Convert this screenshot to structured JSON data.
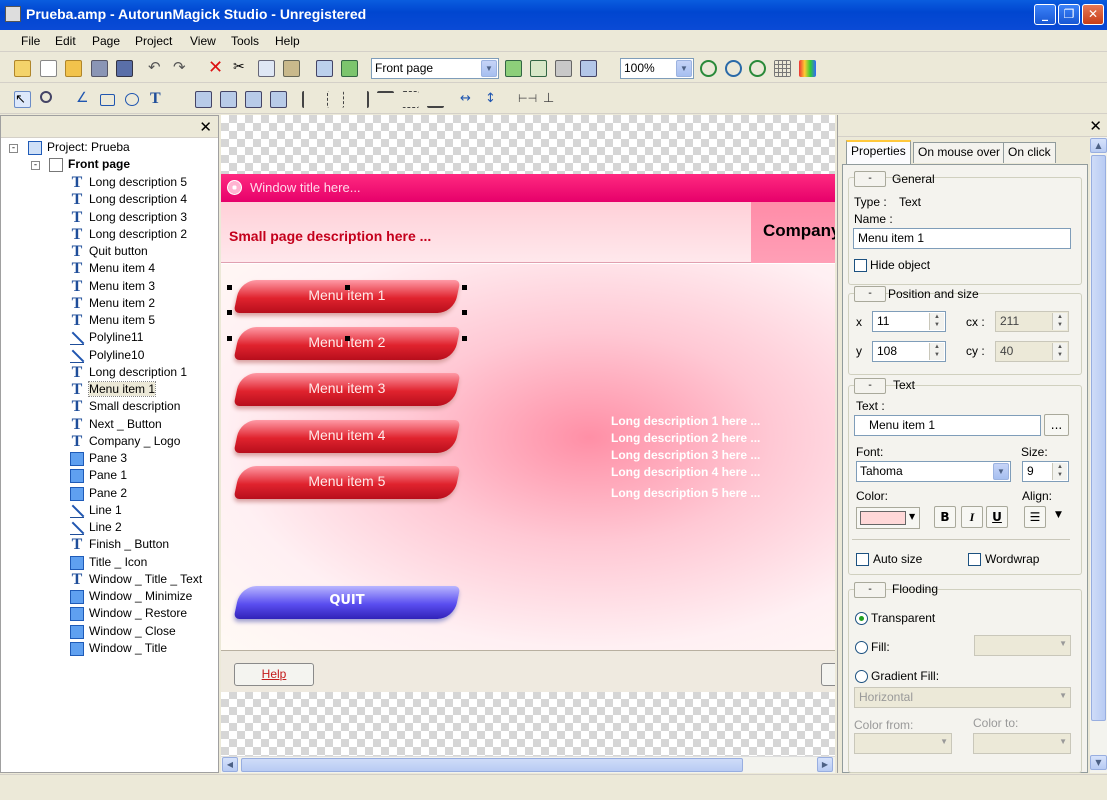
{
  "window": {
    "title": "Prueba.amp - AutorunMagick Studio - Unregistered"
  },
  "menu": [
    "File",
    "Edit",
    "Page",
    "Project",
    "View",
    "Tools",
    "Help"
  ],
  "toolbar": {
    "page_select": "Front page",
    "zoom": "100%"
  },
  "tree": {
    "root": "Project: Prueba",
    "page": "Front page",
    "items": [
      {
        "label": "Long description 5",
        "icon": "text-icon"
      },
      {
        "label": "Long description 4",
        "icon": "text-icon"
      },
      {
        "label": "Long description 3",
        "icon": "text-icon"
      },
      {
        "label": "Long description 2",
        "icon": "text-icon"
      },
      {
        "label": "Quit button",
        "icon": "text-icon"
      },
      {
        "label": "Menu item 4",
        "icon": "text-icon"
      },
      {
        "label": "Menu item 3",
        "icon": "text-icon"
      },
      {
        "label": "Menu item 2",
        "icon": "text-icon"
      },
      {
        "label": "Menu item 5",
        "icon": "text-icon"
      },
      {
        "label": "Polyline11",
        "icon": "line-icon"
      },
      {
        "label": "Polyline10",
        "icon": "line-icon"
      },
      {
        "label": "Long description 1",
        "icon": "text-icon"
      },
      {
        "label": "Menu item 1",
        "icon": "text-icon",
        "selected": true
      },
      {
        "label": "Small description",
        "icon": "text-icon"
      },
      {
        "label": "Next _ Button",
        "icon": "text-icon"
      },
      {
        "label": "Company _ Logo",
        "icon": "text-icon"
      },
      {
        "label": "Pane 3",
        "icon": "pane-icon"
      },
      {
        "label": "Pane 1",
        "icon": "pane-icon"
      },
      {
        "label": "Pane 2",
        "icon": "pane-icon"
      },
      {
        "label": "Line 1",
        "icon": "line-icon"
      },
      {
        "label": "Line 2",
        "icon": "line-icon"
      },
      {
        "label": "Finish _ Button",
        "icon": "text-icon"
      },
      {
        "label": "Title _ Icon",
        "icon": "pane-icon"
      },
      {
        "label": "Window _ Title _ Text",
        "icon": "text-icon"
      },
      {
        "label": "Window _ Minimize",
        "icon": "pane-icon"
      },
      {
        "label": "Window _ Restore",
        "icon": "pane-icon"
      },
      {
        "label": "Window _ Close",
        "icon": "pane-icon"
      },
      {
        "label": "Window _ Title",
        "icon": "pane-icon"
      }
    ]
  },
  "canvas": {
    "window_title": "Window title here...",
    "small_desc": "Small page description here ...",
    "company": "Company",
    "menu_items": [
      "Menu item 1",
      "Menu item 2",
      "Menu item 3",
      "Menu item 4",
      "Menu item 5"
    ],
    "quit": "QUIT",
    "long_desc": [
      "Long description 1 here ...",
      "Long description 2 here ...",
      "Long description 3 here ...",
      "Long description 4 here ...",
      "Long description 5 here ..."
    ],
    "help": "Help"
  },
  "props": {
    "tabs": [
      "Properties",
      "On mouse over",
      "On click"
    ],
    "general": {
      "title": "General",
      "type_label": "Type :",
      "type_value": "Text",
      "name_label": "Name :",
      "name_value": "Menu item 1",
      "hide": "Hide object"
    },
    "position": {
      "title": "Position and size",
      "x_label": "x",
      "x": "11",
      "y_label": "y",
      "y": "108",
      "cx_label": "cx :",
      "cx": "211",
      "cy_label": "cy :",
      "cy": "40"
    },
    "text": {
      "title": "Text",
      "text_label": "Text :",
      "text_value": "Menu item 1",
      "browse": "...",
      "font_label": "Font:",
      "font": "Tahoma",
      "size_label": "Size:",
      "size": "9",
      "color_label": "Color:",
      "align_label": "Align:",
      "bold": "B",
      "italic": "I",
      "underline": "U",
      "autosize": "Auto size",
      "wordwrap": "Wordwrap"
    },
    "flooding": {
      "title": "Flooding",
      "transparent": "Transparent",
      "fill": "Fill:",
      "gradient": "Gradient Fill:",
      "direction": "Horizontal",
      "color_from": "Color from:",
      "color_to": "Color to:"
    },
    "collapse": "-"
  },
  "colors": {
    "title_pink": "#e6006a",
    "menu_red": "#e0232e",
    "quit_blue": "#5a4ef0",
    "text_color_swatch": "#ffd8d8"
  }
}
